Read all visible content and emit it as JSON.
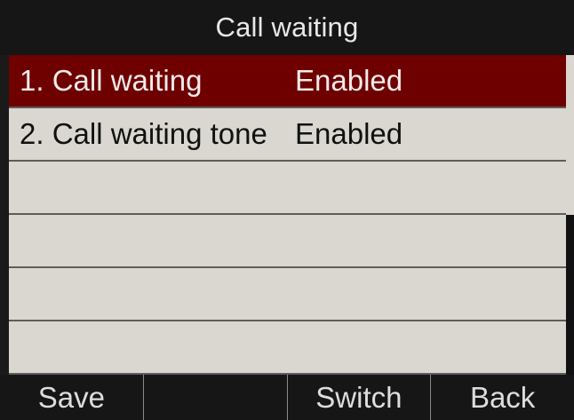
{
  "title": "Call waiting",
  "items": [
    {
      "label": "1. Call waiting",
      "value": "Enabled"
    },
    {
      "label": "2. Call waiting tone",
      "value": "Enabled"
    },
    {
      "label": "",
      "value": ""
    },
    {
      "label": "",
      "value": ""
    },
    {
      "label": "",
      "value": ""
    },
    {
      "label": "",
      "value": ""
    }
  ],
  "softkeys": [
    "Save",
    "",
    "Switch",
    "Back"
  ],
  "colors": {
    "selection": "#6e0000",
    "list_background": "#d9d7cf",
    "bar_background": "#161616"
  }
}
